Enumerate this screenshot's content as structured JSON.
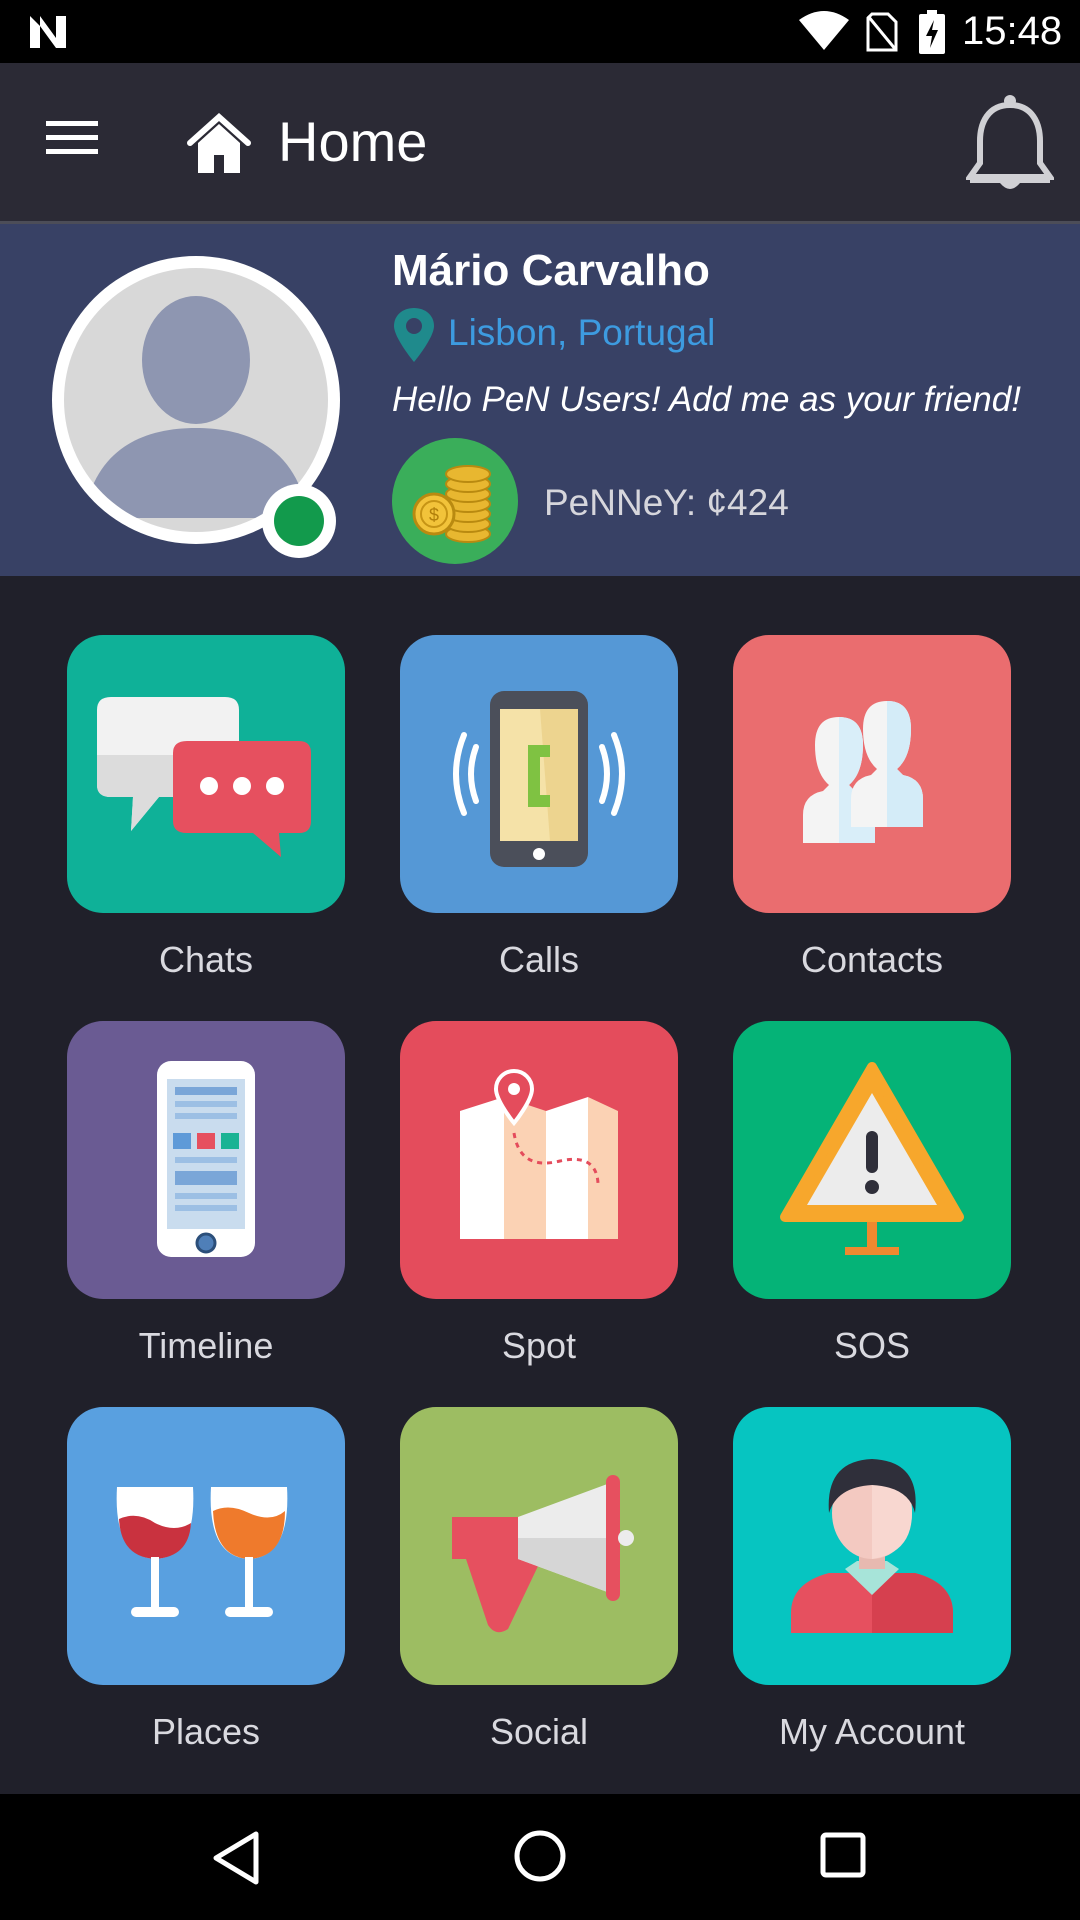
{
  "status_bar": {
    "time": "15:48",
    "icons": [
      "n-logo-icon",
      "wifi-icon",
      "no-sim-icon",
      "battery-charging-icon"
    ]
  },
  "app_bar": {
    "title": "Home",
    "icons": [
      "menu-icon",
      "home-icon",
      "bell-icon"
    ]
  },
  "profile": {
    "name": "Mário Carvalho",
    "location": "Lisbon, Portugal",
    "status_message": "Hello PeN Users! Add me as your friend!",
    "penney": "PeNNeY: ¢424",
    "online": true
  },
  "grid": {
    "tiles": [
      {
        "label": "Chats",
        "icon": "chat-bubbles-icon",
        "color": "#0fb198"
      },
      {
        "label": "Calls",
        "icon": "phone-call-icon",
        "color": "#5598d6"
      },
      {
        "label": "Contacts",
        "icon": "contacts-icon",
        "color": "#ea6d6f"
      },
      {
        "label": "Timeline",
        "icon": "mobile-timeline-icon",
        "color": "#6a5b93"
      },
      {
        "label": "Spot",
        "icon": "map-pin-icon",
        "color": "#e44c5c"
      },
      {
        "label": "SOS",
        "icon": "warning-sign-icon",
        "color": "#05b377"
      },
      {
        "label": "Places",
        "icon": "wine-glasses-icon",
        "color": "#59a0e0"
      },
      {
        "label": "Social",
        "icon": "megaphone-icon",
        "color": "#9dbd62"
      },
      {
        "label": "My Account",
        "icon": "user-account-icon",
        "color": "#06c5c1"
      }
    ]
  },
  "nav_bar": {
    "icons": [
      "back-icon",
      "home-circle-icon",
      "recents-icon"
    ]
  }
}
